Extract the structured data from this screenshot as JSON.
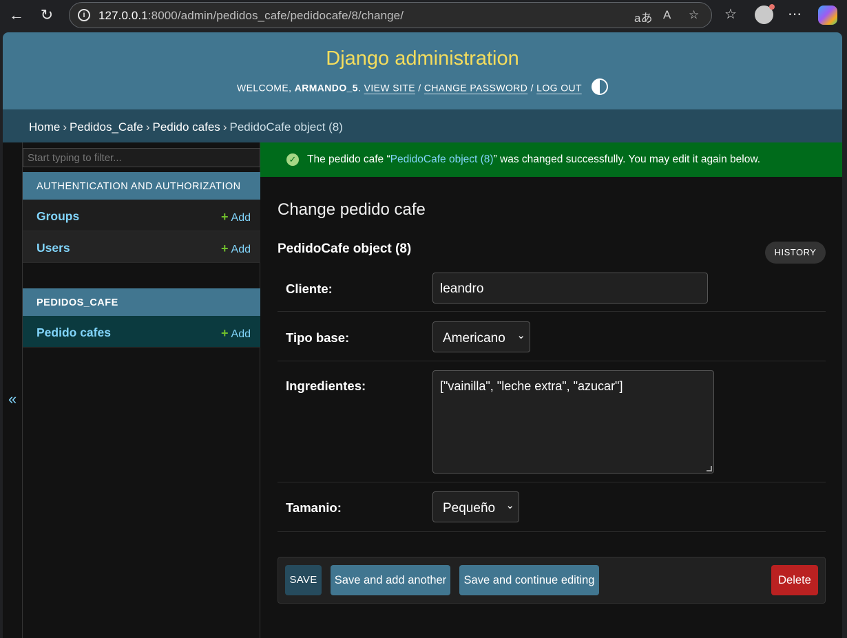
{
  "browser": {
    "url_host": "127.0.0.1",
    "url_rest": ":8000/admin/pedidos_cafe/pedidocafe/8/change/"
  },
  "header": {
    "branding": "Django administration",
    "welcome": "WELCOME,",
    "username": "ARMANDO_5",
    "view_site": "VIEW SITE",
    "change_password": "CHANGE PASSWORD",
    "log_out": "LOG OUT"
  },
  "breadcrumbs": {
    "home": "Home",
    "app": "Pedidos_Cafe",
    "model": "Pedido cafes",
    "current": "PedidoCafe object (8)",
    "separator": "›"
  },
  "sidebar": {
    "filter_placeholder": "Start typing to filter...",
    "toggle": "«",
    "add_label": "Add",
    "apps": [
      {
        "caption": "AUTHENTICATION AND AUTHORIZATION",
        "models": [
          "Groups",
          "Users"
        ]
      },
      {
        "caption": "PEDIDOS_CAFE",
        "models": [
          "Pedido cafes"
        ]
      }
    ]
  },
  "message": {
    "prefix": "The pedido cafe “",
    "object_link": "PedidoCafe object (8)",
    "suffix": "” was changed successfully. You may edit it again below."
  },
  "content": {
    "title": "Change pedido cafe",
    "object_title": "PedidoCafe object (8)",
    "history": "HISTORY"
  },
  "form": {
    "cliente": {
      "label": "Cliente:",
      "value": "leandro"
    },
    "tipo_base": {
      "label": "Tipo base:",
      "value": "Americano"
    },
    "ingredientes": {
      "label": "Ingredientes:",
      "value": "[\"vainilla\", \"leche extra\", \"azucar\"]"
    },
    "tamanio": {
      "label": "Tamanio:",
      "value": "Pequeño"
    }
  },
  "actions": {
    "save": "SAVE",
    "save_add": "Save and add another",
    "save_continue": "Save and continue editing",
    "delete": "Delete"
  },
  "colors": {
    "header_bg": "#417690",
    "branding": "#f5dd5d",
    "breadcrumbs_bg": "#264b5d",
    "success_bg": "#006b1b",
    "link": "#81d4fa",
    "delete_bg": "#ba2121"
  }
}
